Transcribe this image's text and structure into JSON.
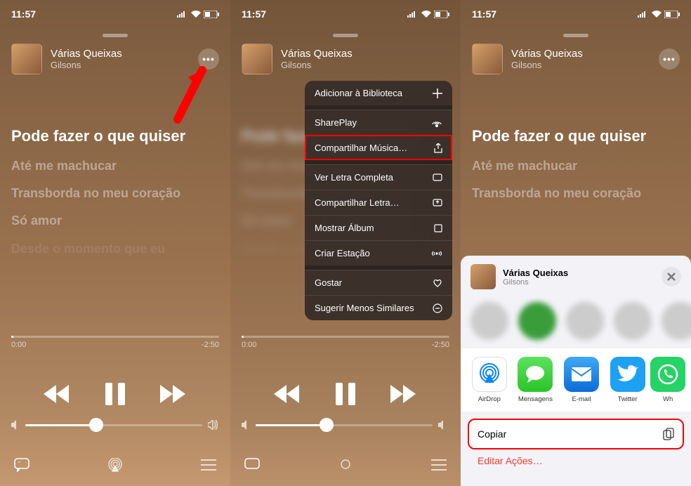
{
  "status": {
    "time": "11:57"
  },
  "track": {
    "title": "Várias Queixas",
    "artist": "Gilsons"
  },
  "lyrics": {
    "active": "Pode fazer o que quiser",
    "l1": "Até me machucar",
    "l2": "Transborda no meu coração",
    "l3": "Só amor",
    "l4": "Desde o momento que eu"
  },
  "progress": {
    "elapsed": "0:00",
    "remaining": "-2:50"
  },
  "menu": {
    "add_library": "Adicionar à Biblioteca",
    "shareplay": "SharePlay",
    "share_music": "Compartilhar Música…",
    "full_lyrics": "Ver Letra Completa",
    "share_lyrics": "Compartilhar Letra…",
    "show_album": "Mostrar Álbum",
    "create_station": "Criar Estação",
    "like": "Gostar",
    "suggest_less": "Sugerir Menos Similares"
  },
  "share": {
    "apps": {
      "airdrop": "AirDrop",
      "messages": "Mensagens",
      "email": "E-mail",
      "twitter": "Twitter",
      "whatsapp": "Wh"
    },
    "copy": "Copiar",
    "edit_actions": "Editar Ações…"
  }
}
